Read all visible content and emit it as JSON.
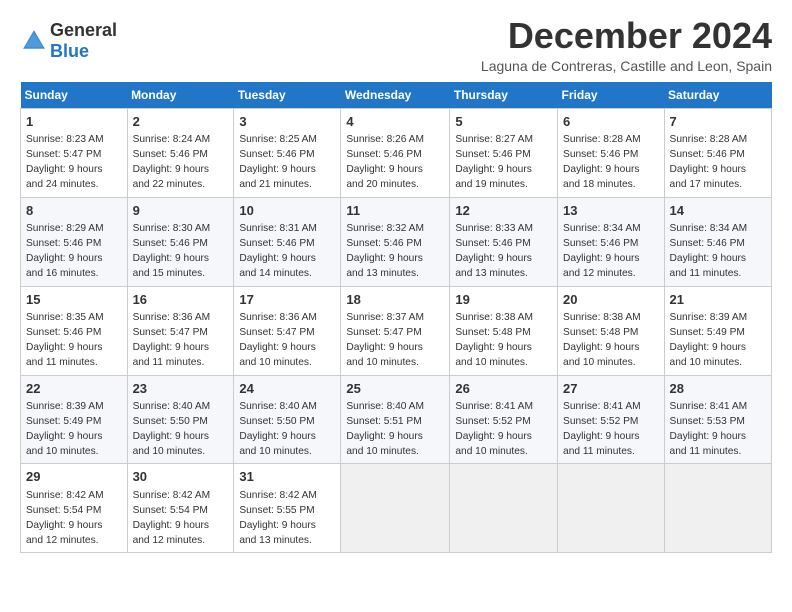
{
  "logo": {
    "general": "General",
    "blue": "Blue"
  },
  "title": "December 2024",
  "location": "Laguna de Contreras, Castille and Leon, Spain",
  "days_header": [
    "Sunday",
    "Monday",
    "Tuesday",
    "Wednesday",
    "Thursday",
    "Friday",
    "Saturday"
  ],
  "weeks": [
    [
      {
        "day": "1",
        "lines": [
          "Sunrise: 8:23 AM",
          "Sunset: 5:47 PM",
          "Daylight: 9 hours",
          "and 24 minutes."
        ]
      },
      {
        "day": "2",
        "lines": [
          "Sunrise: 8:24 AM",
          "Sunset: 5:46 PM",
          "Daylight: 9 hours",
          "and 22 minutes."
        ]
      },
      {
        "day": "3",
        "lines": [
          "Sunrise: 8:25 AM",
          "Sunset: 5:46 PM",
          "Daylight: 9 hours",
          "and 21 minutes."
        ]
      },
      {
        "day": "4",
        "lines": [
          "Sunrise: 8:26 AM",
          "Sunset: 5:46 PM",
          "Daylight: 9 hours",
          "and 20 minutes."
        ]
      },
      {
        "day": "5",
        "lines": [
          "Sunrise: 8:27 AM",
          "Sunset: 5:46 PM",
          "Daylight: 9 hours",
          "and 19 minutes."
        ]
      },
      {
        "day": "6",
        "lines": [
          "Sunrise: 8:28 AM",
          "Sunset: 5:46 PM",
          "Daylight: 9 hours",
          "and 18 minutes."
        ]
      },
      {
        "day": "7",
        "lines": [
          "Sunrise: 8:28 AM",
          "Sunset: 5:46 PM",
          "Daylight: 9 hours",
          "and 17 minutes."
        ]
      }
    ],
    [
      {
        "day": "8",
        "lines": [
          "Sunrise: 8:29 AM",
          "Sunset: 5:46 PM",
          "Daylight: 9 hours",
          "and 16 minutes."
        ]
      },
      {
        "day": "9",
        "lines": [
          "Sunrise: 8:30 AM",
          "Sunset: 5:46 PM",
          "Daylight: 9 hours",
          "and 15 minutes."
        ]
      },
      {
        "day": "10",
        "lines": [
          "Sunrise: 8:31 AM",
          "Sunset: 5:46 PM",
          "Daylight: 9 hours",
          "and 14 minutes."
        ]
      },
      {
        "day": "11",
        "lines": [
          "Sunrise: 8:32 AM",
          "Sunset: 5:46 PM",
          "Daylight: 9 hours",
          "and 13 minutes."
        ]
      },
      {
        "day": "12",
        "lines": [
          "Sunrise: 8:33 AM",
          "Sunset: 5:46 PM",
          "Daylight: 9 hours",
          "and 13 minutes."
        ]
      },
      {
        "day": "13",
        "lines": [
          "Sunrise: 8:34 AM",
          "Sunset: 5:46 PM",
          "Daylight: 9 hours",
          "and 12 minutes."
        ]
      },
      {
        "day": "14",
        "lines": [
          "Sunrise: 8:34 AM",
          "Sunset: 5:46 PM",
          "Daylight: 9 hours",
          "and 11 minutes."
        ]
      }
    ],
    [
      {
        "day": "15",
        "lines": [
          "Sunrise: 8:35 AM",
          "Sunset: 5:46 PM",
          "Daylight: 9 hours",
          "and 11 minutes."
        ]
      },
      {
        "day": "16",
        "lines": [
          "Sunrise: 8:36 AM",
          "Sunset: 5:47 PM",
          "Daylight: 9 hours",
          "and 11 minutes."
        ]
      },
      {
        "day": "17",
        "lines": [
          "Sunrise: 8:36 AM",
          "Sunset: 5:47 PM",
          "Daylight: 9 hours",
          "and 10 minutes."
        ]
      },
      {
        "day": "18",
        "lines": [
          "Sunrise: 8:37 AM",
          "Sunset: 5:47 PM",
          "Daylight: 9 hours",
          "and 10 minutes."
        ]
      },
      {
        "day": "19",
        "lines": [
          "Sunrise: 8:38 AM",
          "Sunset: 5:48 PM",
          "Daylight: 9 hours",
          "and 10 minutes."
        ]
      },
      {
        "day": "20",
        "lines": [
          "Sunrise: 8:38 AM",
          "Sunset: 5:48 PM",
          "Daylight: 9 hours",
          "and 10 minutes."
        ]
      },
      {
        "day": "21",
        "lines": [
          "Sunrise: 8:39 AM",
          "Sunset: 5:49 PM",
          "Daylight: 9 hours",
          "and 10 minutes."
        ]
      }
    ],
    [
      {
        "day": "22",
        "lines": [
          "Sunrise: 8:39 AM",
          "Sunset: 5:49 PM",
          "Daylight: 9 hours",
          "and 10 minutes."
        ]
      },
      {
        "day": "23",
        "lines": [
          "Sunrise: 8:40 AM",
          "Sunset: 5:50 PM",
          "Daylight: 9 hours",
          "and 10 minutes."
        ]
      },
      {
        "day": "24",
        "lines": [
          "Sunrise: 8:40 AM",
          "Sunset: 5:50 PM",
          "Daylight: 9 hours",
          "and 10 minutes."
        ]
      },
      {
        "day": "25",
        "lines": [
          "Sunrise: 8:40 AM",
          "Sunset: 5:51 PM",
          "Daylight: 9 hours",
          "and 10 minutes."
        ]
      },
      {
        "day": "26",
        "lines": [
          "Sunrise: 8:41 AM",
          "Sunset: 5:52 PM",
          "Daylight: 9 hours",
          "and 10 minutes."
        ]
      },
      {
        "day": "27",
        "lines": [
          "Sunrise: 8:41 AM",
          "Sunset: 5:52 PM",
          "Daylight: 9 hours",
          "and 11 minutes."
        ]
      },
      {
        "day": "28",
        "lines": [
          "Sunrise: 8:41 AM",
          "Sunset: 5:53 PM",
          "Daylight: 9 hours",
          "and 11 minutes."
        ]
      }
    ],
    [
      {
        "day": "29",
        "lines": [
          "Sunrise: 8:42 AM",
          "Sunset: 5:54 PM",
          "Daylight: 9 hours",
          "and 12 minutes."
        ]
      },
      {
        "day": "30",
        "lines": [
          "Sunrise: 8:42 AM",
          "Sunset: 5:54 PM",
          "Daylight: 9 hours",
          "and 12 minutes."
        ]
      },
      {
        "day": "31",
        "lines": [
          "Sunrise: 8:42 AM",
          "Sunset: 5:55 PM",
          "Daylight: 9 hours",
          "and 13 minutes."
        ]
      },
      null,
      null,
      null,
      null
    ]
  ]
}
